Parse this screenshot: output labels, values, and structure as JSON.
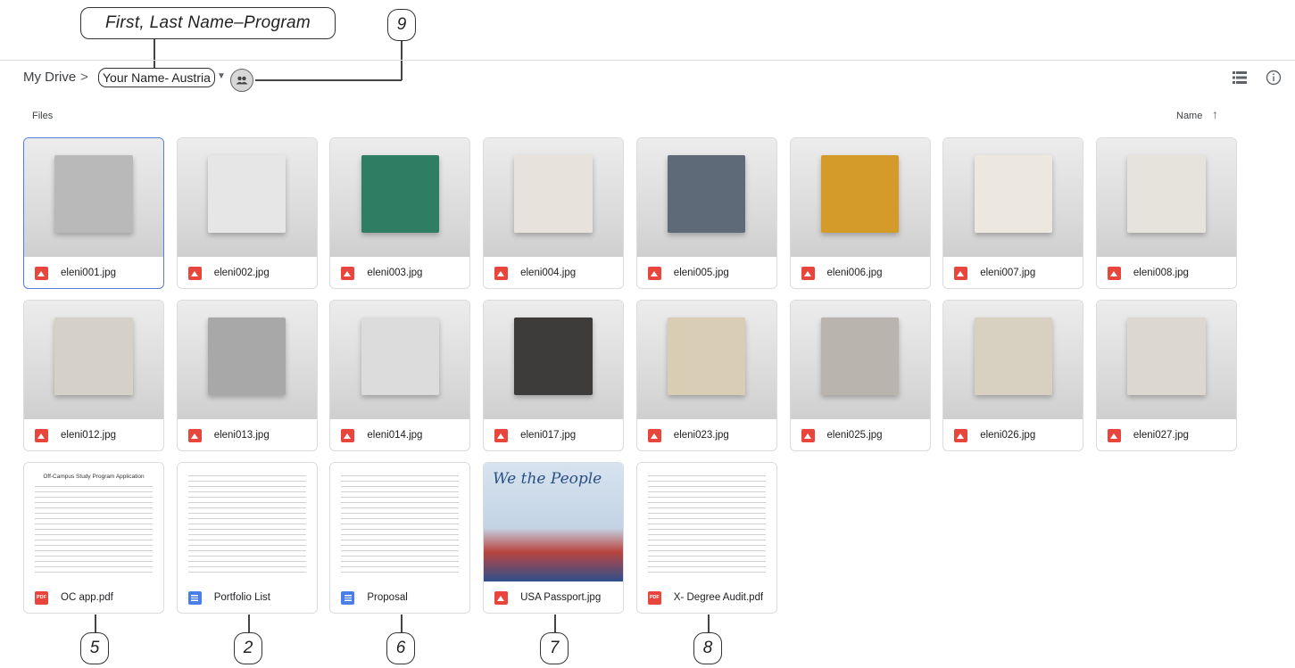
{
  "annotations": {
    "name_callout": "First, Last Name–Program",
    "num_share": "9",
    "num_oc": "5",
    "num_portfolio": "2",
    "num_proposal": "6",
    "num_passport": "7",
    "num_audit": "8"
  },
  "breadcrumb": {
    "root": "My Drive",
    "separator": ">",
    "folder": "Your Name- Austria"
  },
  "files_header": {
    "label": "Files",
    "sort": "Name"
  },
  "icons": {
    "shared": "people-icon",
    "list_view": "list-view-icon",
    "info": "info-icon",
    "sort": "arrow-up-icon",
    "image_file": "image-file-icon",
    "pdf_file": "pdf-file-icon",
    "doc_file": "docs-file-icon"
  },
  "colors": {
    "image_icon": "#e8453c",
    "pdf_icon": "#e8453c",
    "doc_icon": "#4a7ee8",
    "selected_border": "#4f7fd6"
  },
  "files": [
    {
      "name": "eleni001.jpg",
      "type": "image",
      "selected": true
    },
    {
      "name": "eleni002.jpg",
      "type": "image"
    },
    {
      "name": "eleni003.jpg",
      "type": "image"
    },
    {
      "name": "eleni004.jpg",
      "type": "image"
    },
    {
      "name": "eleni005.jpg",
      "type": "image"
    },
    {
      "name": "eleni006.jpg",
      "type": "image"
    },
    {
      "name": "eleni007.jpg",
      "type": "image"
    },
    {
      "name": "eleni008.jpg",
      "type": "image"
    },
    {
      "name": "eleni012.jpg",
      "type": "image"
    },
    {
      "name": "eleni013.jpg",
      "type": "image"
    },
    {
      "name": "eleni014.jpg",
      "type": "image"
    },
    {
      "name": "eleni017.jpg",
      "type": "image"
    },
    {
      "name": "eleni023.jpg",
      "type": "image"
    },
    {
      "name": "eleni025.jpg",
      "type": "image"
    },
    {
      "name": "eleni026.jpg",
      "type": "image"
    },
    {
      "name": "eleni027.jpg",
      "type": "image"
    },
    {
      "name": "OC app.pdf",
      "type": "pdf",
      "thumb_title": "Off-Campus Study Program Application"
    },
    {
      "name": "Portfolio List",
      "type": "doc"
    },
    {
      "name": "Proposal",
      "type": "doc"
    },
    {
      "name": "USA Passport.jpg",
      "type": "image",
      "thumb_title": "We the People"
    },
    {
      "name": "X- Degree Audit.pdf",
      "type": "pdf"
    }
  ],
  "pdf_label": "PDF"
}
